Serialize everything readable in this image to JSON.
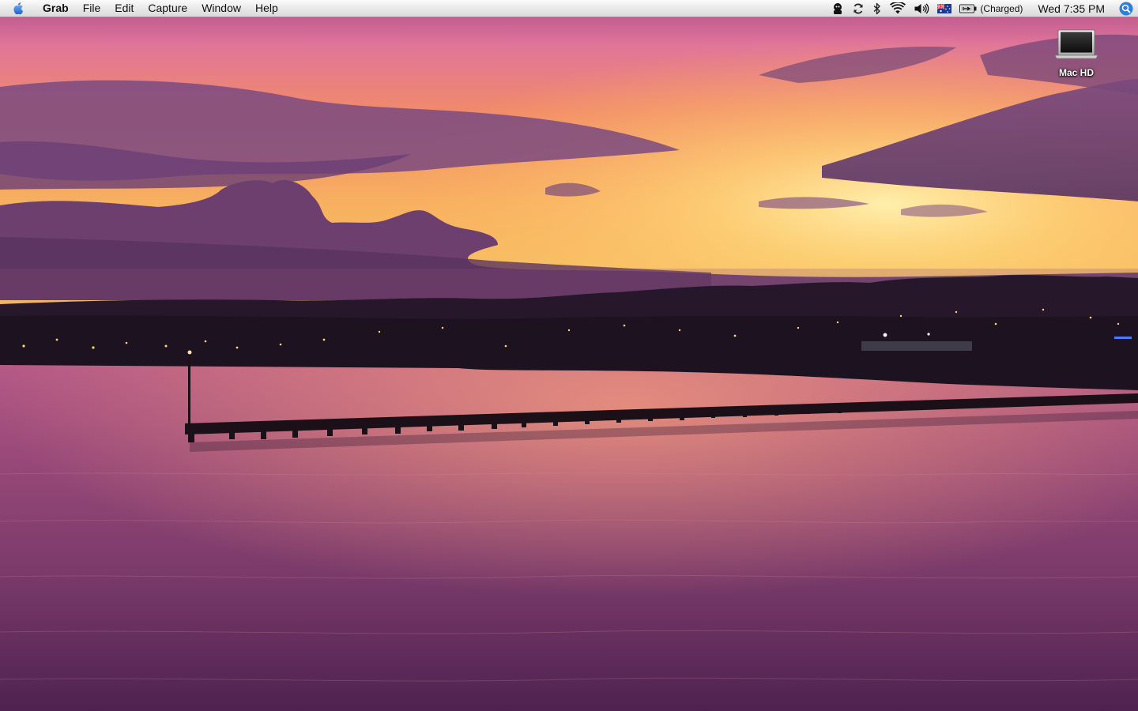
{
  "menubar": {
    "apple_icon": "apple-icon",
    "app_name": "Grab",
    "menus": [
      "File",
      "Edit",
      "Capture",
      "Window",
      "Help"
    ],
    "status_icons": [
      "user-icon",
      "sync-icon",
      "bluetooth-icon",
      "wifi-icon",
      "volume-icon",
      "australia-flag-icon",
      "battery-icon"
    ],
    "battery_status": "(Charged)",
    "clock": "Wed 7:35 PM",
    "spotlight_icon": "spotlight-icon"
  },
  "desktop": {
    "icons": [
      {
        "label": "Mac HD",
        "icon": "hard-drive-icon"
      }
    ]
  },
  "colors": {
    "sky_top": "#c46a9a",
    "sky_glow": "#ffd070",
    "water": "#7a3d6a",
    "spotlight_accent": "#2f7de1"
  }
}
